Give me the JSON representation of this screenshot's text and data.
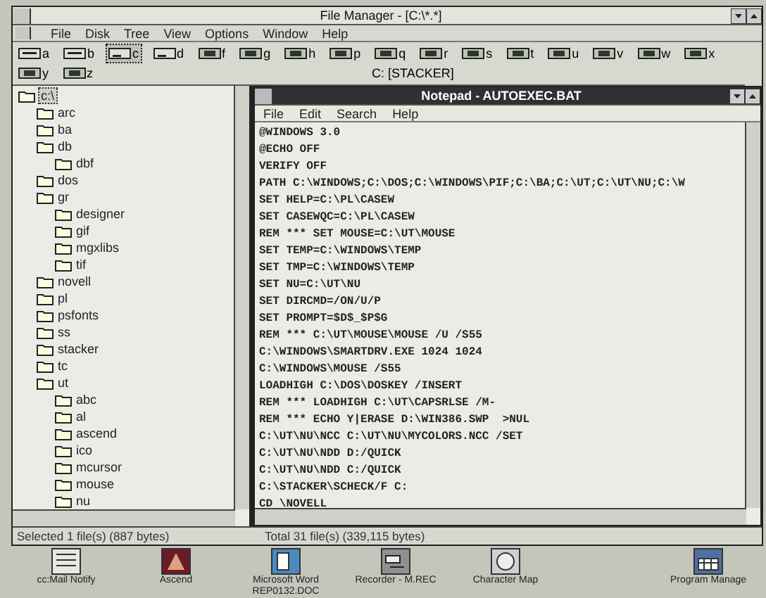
{
  "window": {
    "title": "File Manager - [C:\\*.*]"
  },
  "menu": [
    "File",
    "Disk",
    "Tree",
    "View",
    "Options",
    "Window",
    "Help"
  ],
  "drives": [
    {
      "letter": "a",
      "kind": "floppy",
      "selected": false
    },
    {
      "letter": "b",
      "kind": "floppy",
      "selected": false
    },
    {
      "letter": "c",
      "kind": "hard",
      "selected": true
    },
    {
      "letter": "d",
      "kind": "hard",
      "selected": false
    },
    {
      "letter": "f",
      "kind": "network",
      "selected": false
    },
    {
      "letter": "g",
      "kind": "network",
      "selected": false
    },
    {
      "letter": "h",
      "kind": "network",
      "selected": false
    },
    {
      "letter": "p",
      "kind": "network",
      "selected": false
    },
    {
      "letter": "q",
      "kind": "network",
      "selected": false
    },
    {
      "letter": "r",
      "kind": "network",
      "selected": false
    },
    {
      "letter": "s",
      "kind": "network",
      "selected": false
    },
    {
      "letter": "t",
      "kind": "network",
      "selected": false
    },
    {
      "letter": "u",
      "kind": "network",
      "selected": false
    },
    {
      "letter": "v",
      "kind": "network",
      "selected": false
    },
    {
      "letter": "w",
      "kind": "network",
      "selected": false
    },
    {
      "letter": "x",
      "kind": "network",
      "selected": false
    },
    {
      "letter": "y",
      "kind": "network",
      "selected": false
    },
    {
      "letter": "z",
      "kind": "network",
      "selected": false
    }
  ],
  "volume_label": "C: [STACKER]",
  "tree": {
    "label": "c:\\",
    "selected": true,
    "children": [
      {
        "label": "arc",
        "selected": false
      },
      {
        "label": "ba",
        "selected": false
      },
      {
        "label": "db",
        "selected": false,
        "children": [
          {
            "label": "dbf",
            "selected": false
          }
        ]
      },
      {
        "label": "dos",
        "selected": false
      },
      {
        "label": "gr",
        "selected": false,
        "children": [
          {
            "label": "designer",
            "selected": false
          },
          {
            "label": "gif",
            "selected": false
          },
          {
            "label": "mgxlibs",
            "selected": false
          },
          {
            "label": "tif",
            "selected": false
          }
        ]
      },
      {
        "label": "novell",
        "selected": false
      },
      {
        "label": "pl",
        "selected": false
      },
      {
        "label": "psfonts",
        "selected": false
      },
      {
        "label": "ss",
        "selected": false
      },
      {
        "label": "stacker",
        "selected": false
      },
      {
        "label": "tc",
        "selected": false
      },
      {
        "label": "ut",
        "selected": false,
        "children": [
          {
            "label": "abc",
            "selected": false
          },
          {
            "label": "al",
            "selected": false
          },
          {
            "label": "ascend",
            "selected": false
          },
          {
            "label": "ico",
            "selected": false
          },
          {
            "label": "mcursor",
            "selected": false
          },
          {
            "label": "mouse",
            "selected": false
          },
          {
            "label": "nu",
            "selected": false
          }
        ]
      }
    ]
  },
  "notepad": {
    "title": "Notepad - AUTOEXEC.BAT",
    "menu": [
      "File",
      "Edit",
      "Search",
      "Help"
    ],
    "lines": [
      "@WINDOWS 3.0",
      "@ECHO OFF",
      "VERIFY OFF",
      "PATH C:\\WINDOWS;C:\\DOS;C:\\WINDOWS\\PIF;C:\\BA;C:\\UT;C:\\UT\\NU;C:\\W",
      "SET HELP=C:\\PL\\CASEW",
      "SET CASEWQC=C:\\PL\\CASEW",
      "REM *** SET MOUSE=C:\\UT\\MOUSE",
      "SET TEMP=C:\\WINDOWS\\TEMP",
      "SET TMP=C:\\WINDOWS\\TEMP",
      "SET NU=C:\\UT\\NU",
      "SET DIRCMD=/ON/U/P",
      "SET PROMPT=$D$_$P$G",
      "REM *** C:\\UT\\MOUSE\\MOUSE /U /S55",
      "C:\\WINDOWS\\SMARTDRV.EXE 1024 1024",
      "C:\\WINDOWS\\MOUSE /S55",
      "LOADHIGH C:\\DOS\\DOSKEY /INSERT",
      "REM *** LOADHIGH C:\\UT\\CAPSRLSE /M-",
      "REM *** ECHO Y|ERASE D:\\WIN386.SWP  >NUL",
      "C:\\UT\\NU\\NCC C:\\UT\\NU\\MYCOLORS.NCC /SET",
      "C:\\UT\\NU\\NDD D:/QUICK",
      "C:\\UT\\NU\\NDD C:/QUICK",
      "C:\\STACKER\\SCHECK/F C:",
      "CD \\NOVELL"
    ]
  },
  "status": {
    "selected": "Selected 1 file(s) (887 bytes)",
    "total": "Total 31 file(s) (339,115 bytes)"
  },
  "desktop_icons": [
    {
      "label": "cc:Mail Notify",
      "kind": "mail"
    },
    {
      "label": "Ascend",
      "kind": "ascend"
    },
    {
      "label": "Microsoft Word REP0132.DOC",
      "kind": "word"
    },
    {
      "label": "Recorder - M.REC",
      "kind": "recorder"
    },
    {
      "label": "Character Map",
      "kind": "charmap"
    },
    {
      "label": "Program Manage",
      "kind": "progman"
    }
  ]
}
